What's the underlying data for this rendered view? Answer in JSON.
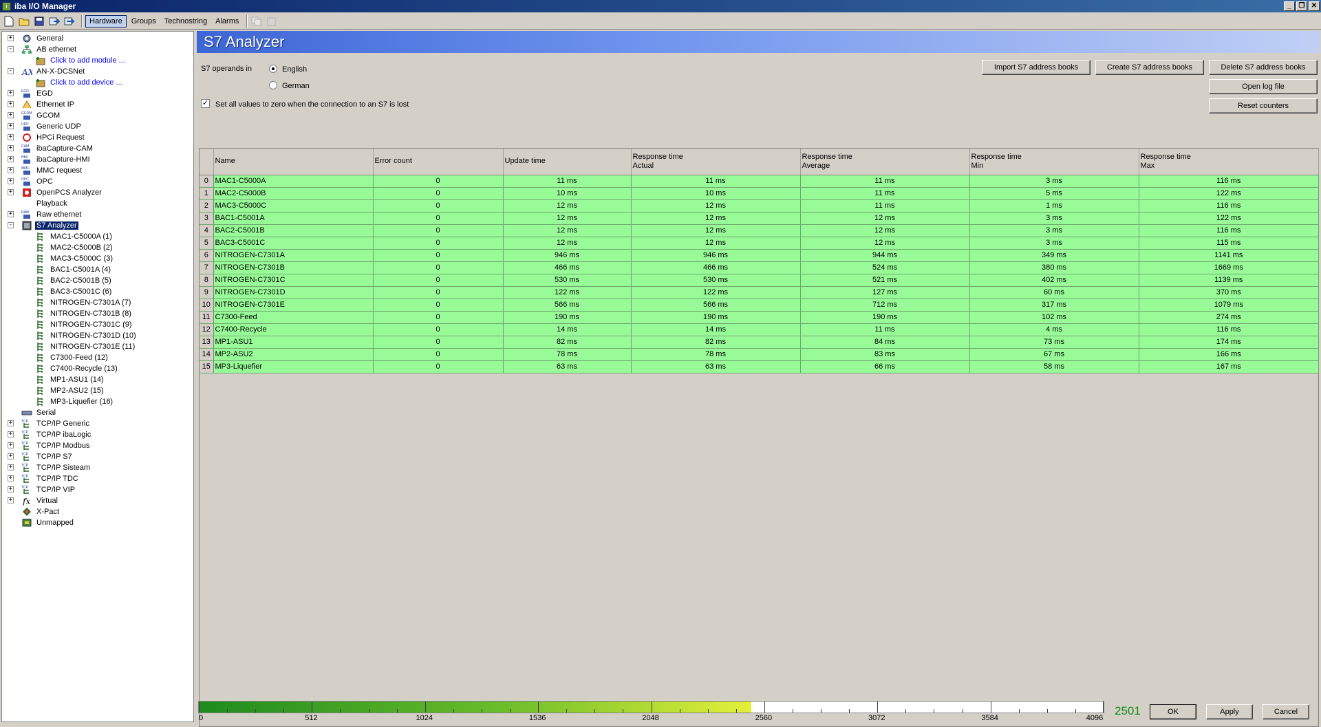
{
  "app": {
    "title": "iba I/O Manager"
  },
  "toolbar": {
    "tabs": [
      {
        "label": "Hardware",
        "active": true
      },
      {
        "label": "Groups",
        "active": false
      },
      {
        "label": "Technostring",
        "active": false
      },
      {
        "label": "Alarms",
        "active": false
      }
    ]
  },
  "tree": {
    "nodes": [
      {
        "label": "General",
        "icon": "gear-icon",
        "expander": "+",
        "level": 0
      },
      {
        "label": "AB ethernet",
        "icon": "network-icon",
        "expander": "-",
        "level": 0
      },
      {
        "label": "Click to add module ...",
        "icon": "add-module-icon",
        "expander": "",
        "level": 1,
        "link": true
      },
      {
        "label": "AN-X-DCSNet",
        "icon": "anx-icon",
        "expander": "-",
        "level": 0
      },
      {
        "label": "Click to add device ...",
        "icon": "add-device-icon",
        "expander": "",
        "level": 1,
        "link": true
      },
      {
        "label": "EGD",
        "icon": "egd-icon",
        "expander": "+",
        "level": 0
      },
      {
        "label": "Ethernet IP",
        "icon": "ethernet-ip-icon",
        "expander": "+",
        "level": 0
      },
      {
        "label": "GCOM",
        "icon": "gcom-icon",
        "expander": "+",
        "level": 0
      },
      {
        "label": "Generic UDP",
        "icon": "udp-icon",
        "expander": "+",
        "level": 0
      },
      {
        "label": "HPCi Request",
        "icon": "hpci-icon",
        "expander": "+",
        "level": 0
      },
      {
        "label": "ibaCapture-CAM",
        "icon": "camera-icon",
        "expander": "+",
        "level": 0
      },
      {
        "label": "ibaCapture-HMI",
        "icon": "hmi-icon",
        "expander": "+",
        "level": 0
      },
      {
        "label": "MMC request",
        "icon": "mmc-icon",
        "expander": "+",
        "level": 0
      },
      {
        "label": "OPC",
        "icon": "opc-icon",
        "expander": "+",
        "level": 0
      },
      {
        "label": "OpenPCS Analyzer",
        "icon": "openpcs-icon",
        "expander": "+",
        "level": 0
      },
      {
        "label": "Playback",
        "icon": "playback-icon",
        "expander": "",
        "level": 0
      },
      {
        "label": "Raw ethernet",
        "icon": "raw-ethernet-icon",
        "expander": "+",
        "level": 0
      },
      {
        "label": "S7 Analyzer",
        "icon": "s7-analyzer-icon",
        "expander": "-",
        "level": 0,
        "selected": true
      },
      {
        "label": "MAC1-C5000A (1)",
        "icon": "plc-icon",
        "expander": "",
        "level": 1
      },
      {
        "label": "MAC2-C5000B (2)",
        "icon": "plc-icon",
        "expander": "",
        "level": 1
      },
      {
        "label": "MAC3-C5000C (3)",
        "icon": "plc-icon",
        "expander": "",
        "level": 1
      },
      {
        "label": "BAC1-C5001A (4)",
        "icon": "plc-icon",
        "expander": "",
        "level": 1
      },
      {
        "label": "BAC2-C5001B (5)",
        "icon": "plc-icon",
        "expander": "",
        "level": 1
      },
      {
        "label": "BAC3-C5001C (6)",
        "icon": "plc-icon",
        "expander": "",
        "level": 1
      },
      {
        "label": "NITROGEN-C7301A (7)",
        "icon": "plc-icon",
        "expander": "",
        "level": 1
      },
      {
        "label": "NITROGEN-C7301B (8)",
        "icon": "plc-icon",
        "expander": "",
        "level": 1
      },
      {
        "label": "NITROGEN-C7301C (9)",
        "icon": "plc-icon",
        "expander": "",
        "level": 1
      },
      {
        "label": "NITROGEN-C7301D (10)",
        "icon": "plc-icon",
        "expander": "",
        "level": 1
      },
      {
        "label": "NITROGEN-C7301E (11)",
        "icon": "plc-icon",
        "expander": "",
        "level": 1
      },
      {
        "label": "C7300-Feed (12)",
        "icon": "plc-icon",
        "expander": "",
        "level": 1
      },
      {
        "label": "C7400-Recycle (13)",
        "icon": "plc-icon",
        "expander": "",
        "level": 1
      },
      {
        "label": "MP1-ASU1 (14)",
        "icon": "plc-icon",
        "expander": "",
        "level": 1
      },
      {
        "label": "MP2-ASU2 (15)",
        "icon": "plc-icon",
        "expander": "",
        "level": 1
      },
      {
        "label": "MP3-Liquefier (16)",
        "icon": "plc-icon",
        "expander": "",
        "level": 1
      },
      {
        "label": "Serial",
        "icon": "serial-icon",
        "expander": "",
        "level": 0
      },
      {
        "label": "TCP/IP Generic",
        "icon": "tcp-icon",
        "expander": "+",
        "level": 0
      },
      {
        "label": "TCP/IP ibaLogic",
        "icon": "tcp-icon",
        "expander": "+",
        "level": 0
      },
      {
        "label": "TCP/IP Modbus",
        "icon": "tcp-icon",
        "expander": "+",
        "level": 0
      },
      {
        "label": "TCP/IP S7",
        "icon": "tcp-icon",
        "expander": "+",
        "level": 0
      },
      {
        "label": "TCP/IP Sisteam",
        "icon": "tcp-icon",
        "expander": "+",
        "level": 0
      },
      {
        "label": "TCP/IP TDC",
        "icon": "tcp-icon",
        "expander": "+",
        "level": 0
      },
      {
        "label": "TCP/IP VIP",
        "icon": "tcp-icon",
        "expander": "+",
        "level": 0
      },
      {
        "label": "Virtual",
        "icon": "function-icon",
        "expander": "+",
        "level": 0
      },
      {
        "label": "X-Pact",
        "icon": "xpact-icon",
        "expander": "",
        "level": 0
      },
      {
        "label": "Unmapped",
        "icon": "unmapped-icon",
        "expander": "",
        "level": 0
      }
    ]
  },
  "panel": {
    "title": "S7 Analyzer",
    "operands_label": "S7 operands in",
    "radio_english": "English",
    "radio_german": "German",
    "zero_checkbox_label": "Set all values to zero when the connection to an S7 is lost",
    "btn_import": "Import S7 address books",
    "btn_create": "Create S7 address books",
    "btn_delete": "Delete S7 address books",
    "btn_open_log": "Open log file",
    "btn_reset": "Reset counters"
  },
  "table": {
    "headers": [
      [
        "Name"
      ],
      [
        "Error count"
      ],
      [
        "Update time"
      ],
      [
        "Response time",
        "Actual"
      ],
      [
        "Response time",
        "Average"
      ],
      [
        "Response time",
        "Min"
      ],
      [
        "Response time",
        "Max"
      ]
    ],
    "rows": [
      {
        "idx": "0",
        "name": "MAC1-C5000A",
        "err": "0",
        "upd": "11 ms",
        "act": "11 ms",
        "avg": "11 ms",
        "min": "3 ms",
        "max": "116 ms"
      },
      {
        "idx": "1",
        "name": "MAC2-C5000B",
        "err": "0",
        "upd": "10 ms",
        "act": "10 ms",
        "avg": "11 ms",
        "min": "5 ms",
        "max": "122 ms"
      },
      {
        "idx": "2",
        "name": "MAC3-C5000C",
        "err": "0",
        "upd": "12 ms",
        "act": "12 ms",
        "avg": "11 ms",
        "min": "1 ms",
        "max": "116 ms"
      },
      {
        "idx": "3",
        "name": "BAC1-C5001A",
        "err": "0",
        "upd": "12 ms",
        "act": "12 ms",
        "avg": "12 ms",
        "min": "3 ms",
        "max": "122 ms"
      },
      {
        "idx": "4",
        "name": "BAC2-C5001B",
        "err": "0",
        "upd": "12 ms",
        "act": "12 ms",
        "avg": "12 ms",
        "min": "3 ms",
        "max": "116 ms"
      },
      {
        "idx": "5",
        "name": "BAC3-C5001C",
        "err": "0",
        "upd": "12 ms",
        "act": "12 ms",
        "avg": "12 ms",
        "min": "3 ms",
        "max": "115 ms"
      },
      {
        "idx": "6",
        "name": "NITROGEN-C7301A",
        "err": "0",
        "upd": "946 ms",
        "act": "946 ms",
        "avg": "944 ms",
        "min": "349 ms",
        "max": "1141 ms"
      },
      {
        "idx": "7",
        "name": "NITROGEN-C7301B",
        "err": "0",
        "upd": "466 ms",
        "act": "466 ms",
        "avg": "524 ms",
        "min": "380 ms",
        "max": "1669 ms"
      },
      {
        "idx": "8",
        "name": "NITROGEN-C7301C",
        "err": "0",
        "upd": "530 ms",
        "act": "530 ms",
        "avg": "521 ms",
        "min": "402 ms",
        "max": "1139 ms"
      },
      {
        "idx": "9",
        "name": "NITROGEN-C7301D",
        "err": "0",
        "upd": "122 ms",
        "act": "122 ms",
        "avg": "127 ms",
        "min": "60 ms",
        "max": "370 ms"
      },
      {
        "idx": "10",
        "name": "NITROGEN-C7301E",
        "err": "0",
        "upd": "566 ms",
        "act": "566 ms",
        "avg": "712 ms",
        "min": "317 ms",
        "max": "1079 ms"
      },
      {
        "idx": "11",
        "name": "C7300-Feed",
        "err": "0",
        "upd": "190 ms",
        "act": "190 ms",
        "avg": "190 ms",
        "min": "102 ms",
        "max": "274 ms"
      },
      {
        "idx": "12",
        "name": "C7400-Recycle",
        "err": "0",
        "upd": "14 ms",
        "act": "14 ms",
        "avg": "11 ms",
        "min": "4 ms",
        "max": "116 ms"
      },
      {
        "idx": "13",
        "name": "MP1-ASU1",
        "err": "0",
        "upd": "82 ms",
        "act": "82 ms",
        "avg": "84 ms",
        "min": "73 ms",
        "max": "174 ms"
      },
      {
        "idx": "14",
        "name": "MP2-ASU2",
        "err": "0",
        "upd": "78 ms",
        "act": "78 ms",
        "avg": "83 ms",
        "min": "67 ms",
        "max": "166 ms"
      },
      {
        "idx": "15",
        "name": "MP3-Liquefier",
        "err": "0",
        "upd": "63 ms",
        "act": "63 ms",
        "avg": "66 ms",
        "min": "58 ms",
        "max": "167 ms"
      }
    ],
    "row_color": "#98fb98"
  },
  "gauge": {
    "value": "2501",
    "current": 2501,
    "max": 4096,
    "labels": [
      "0",
      "512",
      "1024",
      "1536",
      "2048",
      "2560",
      "3072",
      "3584",
      "4096"
    ]
  },
  "footer": {
    "ok": "OK",
    "apply": "Apply",
    "cancel": "Cancel"
  }
}
